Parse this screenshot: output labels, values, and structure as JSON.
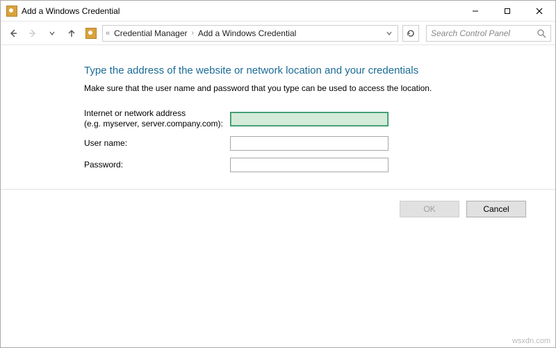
{
  "titlebar": {
    "title": "Add a Windows Credential"
  },
  "nav": {
    "crumb1": "Credential Manager",
    "crumb2": "Add a Windows Credential",
    "search_placeholder": "Search Control Panel"
  },
  "page": {
    "headline": "Type the address of the website or network location and your credentials",
    "subtext": "Make sure that the user name and password that you type can be used to access the location."
  },
  "form": {
    "address_label": "Internet or network address",
    "address_hint": "(e.g. myserver, server.company.com):",
    "address_value": "",
    "username_label": "User name:",
    "username_value": "",
    "password_label": "Password:",
    "password_value": ""
  },
  "buttons": {
    "ok": "OK",
    "cancel": "Cancel"
  },
  "watermark": "wsxdn.com"
}
